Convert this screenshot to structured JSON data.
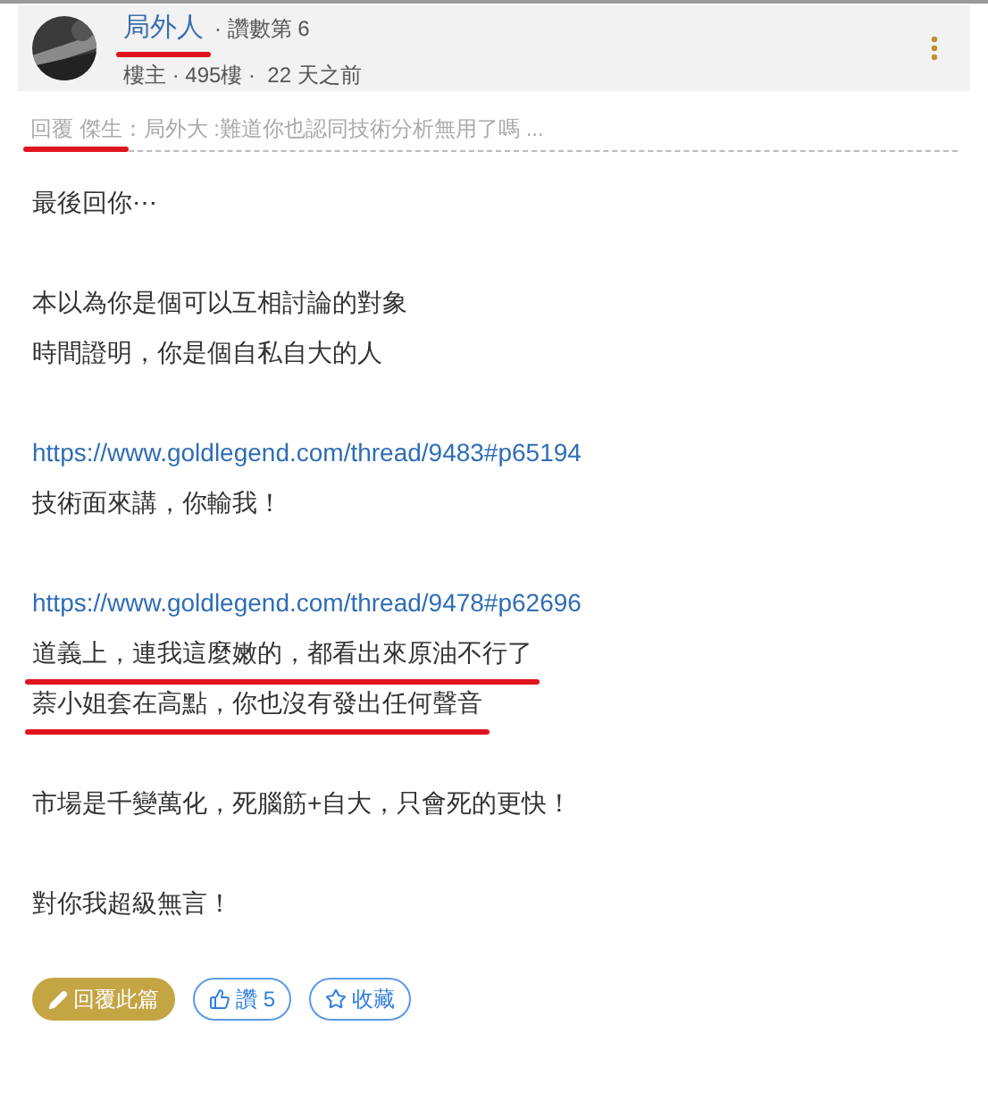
{
  "post": {
    "author": "局外人",
    "author_underlined": true,
    "meta_top": "· 讚數第 6",
    "meta_bottom": "樓主 · 495樓 ·  22 天之前"
  },
  "reply_to": {
    "label": "回覆 傑生",
    "label_underlined": true,
    "quote": "：局外大 :難道你也認同技術分析無用了嗎 ..."
  },
  "blocks": [
    [
      {
        "kind": "text",
        "text": "最後回你⋯",
        "underlined": false
      }
    ],
    [
      {
        "kind": "text",
        "text": "本以為你是個可以互相討論的對象",
        "underlined": false
      },
      {
        "kind": "text",
        "text": "時間證明，你是個自私自大的人",
        "underlined": false
      }
    ],
    [
      {
        "kind": "link",
        "text": "https://www.goldlegend.com/thread/9483#p65194",
        "underlined": false
      },
      {
        "kind": "text",
        "text": "技術面來講，你輸我！",
        "underlined": false
      }
    ],
    [
      {
        "kind": "link",
        "text": "https://www.goldlegend.com/thread/9478#p62696",
        "underlined": false
      },
      {
        "kind": "text",
        "text": "道義上，連我這麼嫩的，都看出來原油不行了",
        "underlined": true
      },
      {
        "kind": "text",
        "text": "萘小姐套在高點，你也沒有發出任何聲音",
        "underlined": true
      }
    ],
    [
      {
        "kind": "text",
        "text": "市場是千變萬化，死腦筋+自大，只會死的更快！",
        "underlined": false
      }
    ],
    [
      {
        "kind": "text",
        "text": "對你我超級無言！",
        "underlined": false
      }
    ]
  ],
  "actions": [
    {
      "kind": "reply",
      "label": "回覆此篇"
    },
    {
      "kind": "like",
      "label": "讚 5"
    },
    {
      "kind": "favorite",
      "label": "收藏"
    }
  ]
}
